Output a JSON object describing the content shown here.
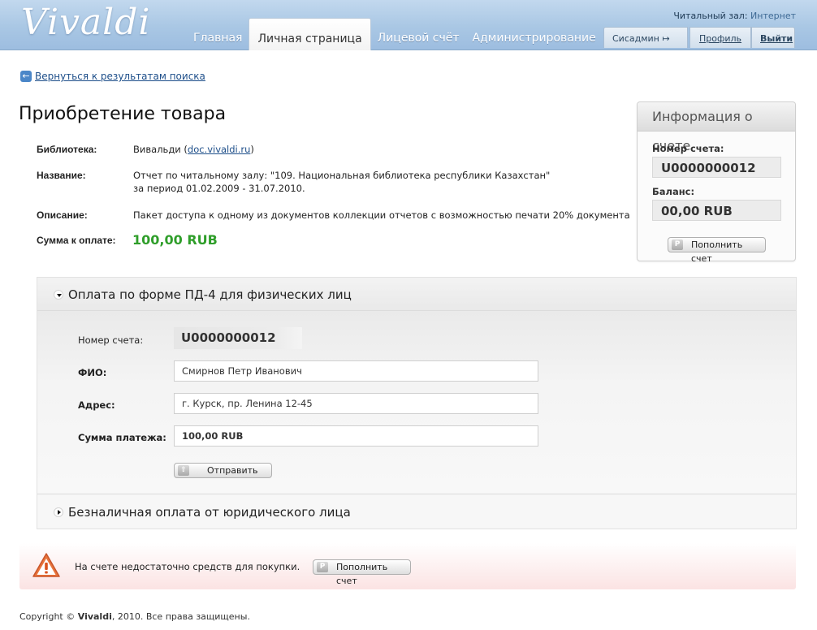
{
  "header": {
    "logo": "Vivaldi",
    "tabs": [
      {
        "label": "Главная"
      },
      {
        "label": "Личная страница"
      },
      {
        "label": "Лицевой счёт"
      },
      {
        "label": "Администрирование"
      }
    ],
    "reading_room_label": "Читальный зал:",
    "reading_room_value": "Интернет",
    "user": "Сисадмин ↦",
    "profile": "Профиль",
    "logout": "Выйти"
  },
  "back_link": "Вернуться к результатам поиска",
  "page_title": "Приобретение товара",
  "details": {
    "library_label": "Библиотека:",
    "library_name": "Вивальди (",
    "library_link": "doc.vivaldi.ru",
    "library_close": ")",
    "name_label": "Название:",
    "name_line1": "Отчет по читальному залу: \"109. Национальная библиотека республики Казахстан\"",
    "name_line2": "за период 01.02.2009 - 31.07.2010.",
    "description_label": "Описание:",
    "description": "Пакет доступа к одному из документов коллекции отчетов с возможностью печати 20% документа",
    "amount_label": "Сумма к оплате:",
    "amount": "100,00 RUB"
  },
  "account_box": {
    "title": "Информация о счете",
    "number_label": "Номер счета:",
    "number": "U0000000012",
    "balance_label": "Баланс:",
    "balance": "00,00 RUB",
    "topup_button": "Пополнить счет",
    "button_icon": "Р"
  },
  "payment": {
    "section1_title": "Оплата по форме ПД-4 для физических лиц",
    "account_label": "Номер счета:",
    "account_value": "U0000000012",
    "fio_label": "ФИО:",
    "fio_value": "Смирнов Петр Иванович",
    "address_label": "Адрес:",
    "address_value": "г. Курск, пр. Ленина 12-45",
    "sum_label": "Сумма платежа:",
    "sum_value": "100,00 RUB",
    "submit_button": "Отправить",
    "section2_title": "Безналичная оплата от юридического лица"
  },
  "warning": {
    "text": "На счете недостаточно средств для покупки.",
    "button": "Пополнить счет",
    "button_icon": "Р"
  },
  "footer": {
    "prefix": "Copyright © ",
    "brand": "Vivaldi",
    "suffix": ", 2010. Все права защищены."
  }
}
